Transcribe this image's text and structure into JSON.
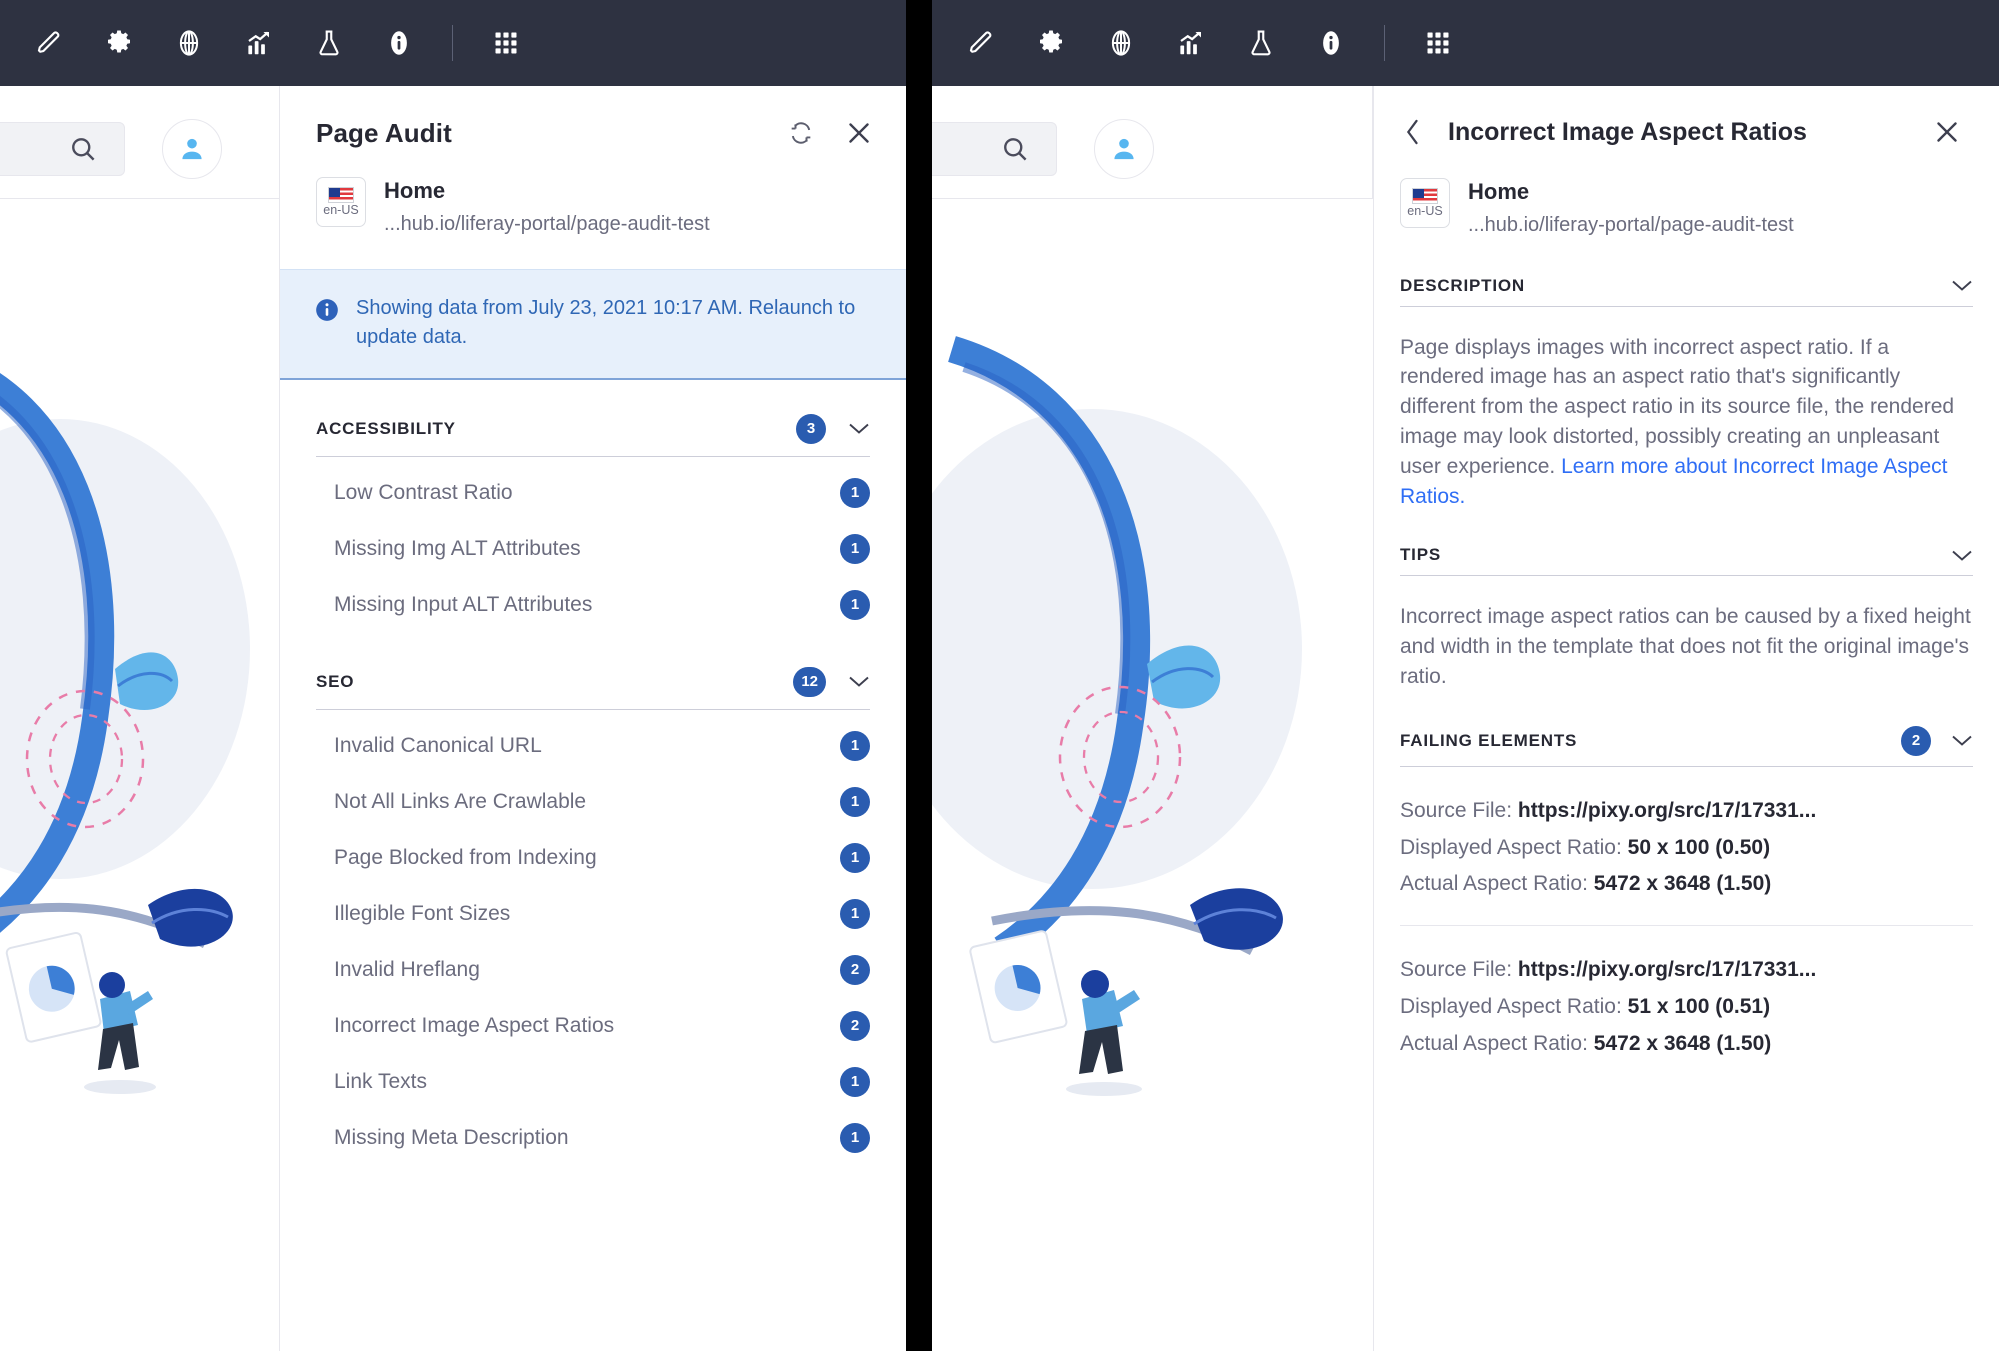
{
  "toolbar": {
    "icons": [
      {
        "name": "pencil-icon",
        "label": "Edit"
      },
      {
        "name": "gear-icon",
        "label": "Settings"
      },
      {
        "name": "globe-icon",
        "label": "Globalization"
      },
      {
        "name": "analytics-icon",
        "label": "Analytics"
      },
      {
        "name": "flask-icon",
        "label": "Experiments"
      },
      {
        "name": "info-icon",
        "label": "Information"
      }
    ],
    "separator": "|",
    "grid_icon": {
      "name": "grid-apps-icon",
      "label": "Applications"
    }
  },
  "subheader": {
    "search_icon": "search-icon",
    "avatar_icon": "user-avatar-icon"
  },
  "audit_panel": {
    "title": "Page Audit",
    "refresh_icon": "refresh-icon",
    "close_icon": "close-icon",
    "page": {
      "flag_code": "en-US",
      "name": "Home",
      "url": "...hub.io/liferay-portal/page-audit-test"
    },
    "notice": {
      "icon": "info-circle-icon",
      "text": "Showing data from July 23, 2021 10:17 AM. Relaunch to update data."
    },
    "sections": [
      {
        "title": "ACCESSIBILITY",
        "count": "3",
        "items": [
          {
            "label": "Low Contrast Ratio",
            "count": "1"
          },
          {
            "label": "Missing Img ALT Attributes",
            "count": "1"
          },
          {
            "label": "Missing Input ALT Attributes",
            "count": "1"
          }
        ]
      },
      {
        "title": "SEO",
        "count": "12",
        "items": [
          {
            "label": "Invalid Canonical URL",
            "count": "1"
          },
          {
            "label": "Not All Links Are Crawlable",
            "count": "1"
          },
          {
            "label": "Page Blocked from Indexing",
            "count": "1"
          },
          {
            "label": "Illegible Font Sizes",
            "count": "1"
          },
          {
            "label": "Invalid Hreflang",
            "count": "2"
          },
          {
            "label": "Incorrect Image Aspect Ratios",
            "count": "2"
          },
          {
            "label": "Link Texts",
            "count": "1"
          },
          {
            "label": "Missing Meta Description",
            "count": "1"
          }
        ]
      }
    ]
  },
  "detail_panel": {
    "back_icon": "chevron-left-icon",
    "title": "Incorrect Image Aspect Ratios",
    "close_icon": "close-icon",
    "page": {
      "flag_code": "en-US",
      "name": "Home",
      "url": "...hub.io/liferay-portal/page-audit-test"
    },
    "description": {
      "title": "DESCRIPTION",
      "body": "Page displays images with incorrect aspect ratio. If a rendered image has an aspect ratio that's significantly different from the aspect ratio in its source file, the rendered image may look distorted, possibly creating an unpleasant user experience. ",
      "link_text": "Learn more about Incorrect Image Aspect Ratios."
    },
    "tips": {
      "title": "TIPS",
      "body": "Incorrect image aspect ratios can be caused by a fixed height and width in the template that does not fit the original image's ratio."
    },
    "failing": {
      "title": "FAILING ELEMENTS",
      "count": "2",
      "labels": {
        "source": "Source File:",
        "displayed": "Displayed Aspect Ratio:",
        "actual": "Actual Aspect Ratio:"
      },
      "elements": [
        {
          "source_file": "https://pixy.org/src/17/17331...",
          "displayed_ratio": "50 x 100 (0.50)",
          "actual_ratio": "5472 x 3648 (1.50)"
        },
        {
          "source_file": "https://pixy.org/src/17/17331...",
          "displayed_ratio": "51 x 100 (0.51)",
          "actual_ratio": "5472 x 3648 (1.50)"
        }
      ]
    }
  },
  "colors": {
    "toolbar_bg": "#2e3241",
    "badge_blue": "#2a5cb0",
    "notice_bg": "#e7f0fb",
    "notice_text": "#2f67b5",
    "link_blue": "#2f6ef5",
    "text_dark": "#272833",
    "text_muted": "#6b6c7e"
  }
}
